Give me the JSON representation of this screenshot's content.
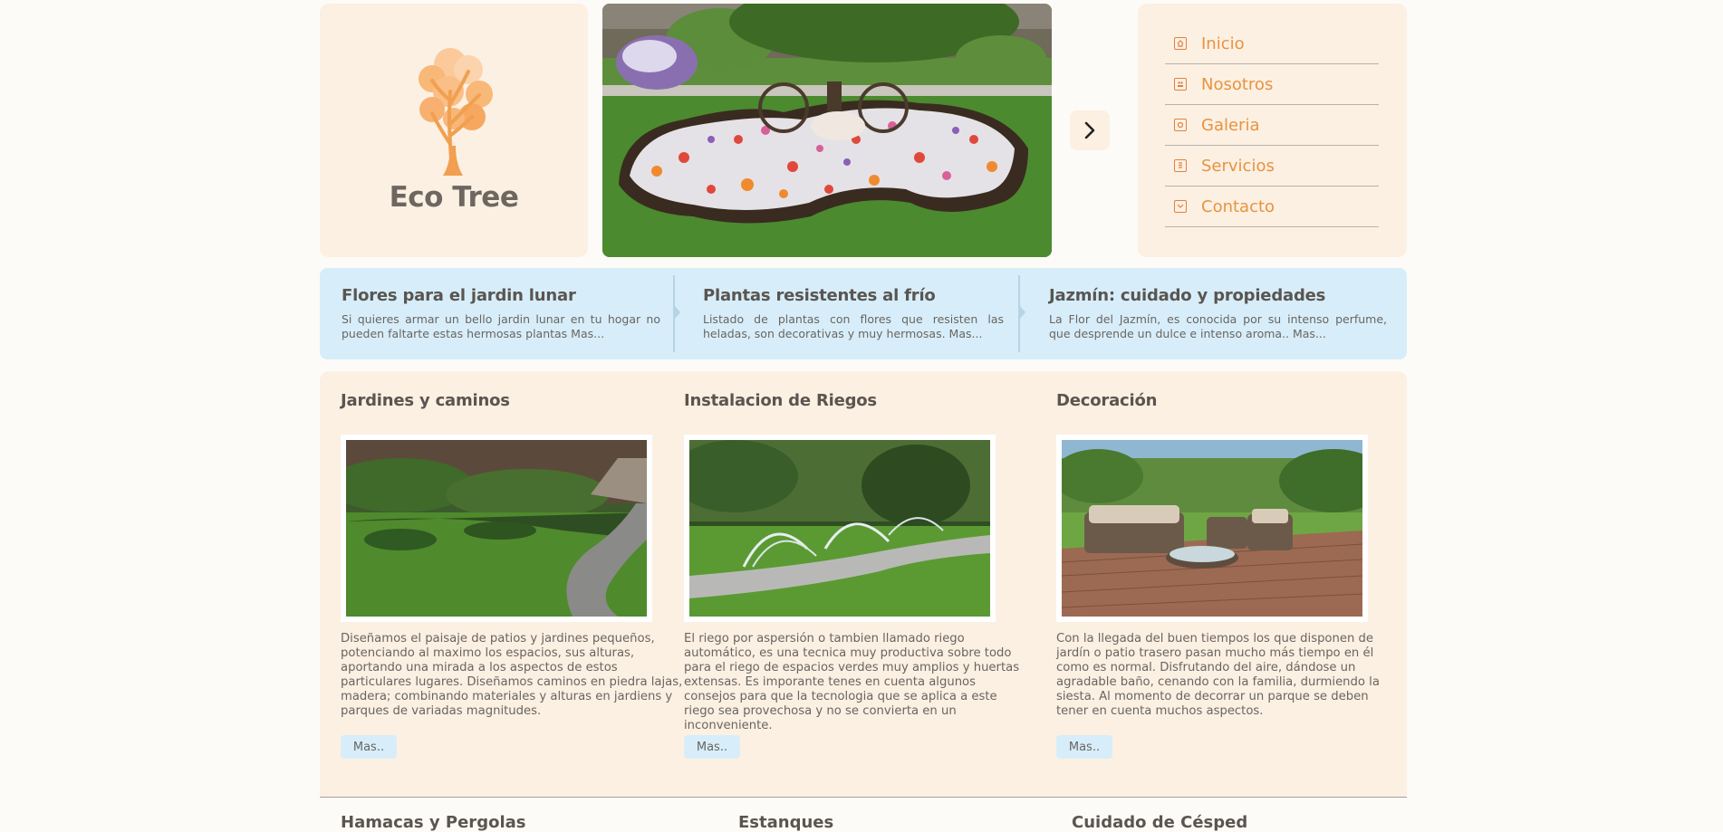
{
  "brand": {
    "name": "Eco Tree"
  },
  "nav": {
    "items": [
      {
        "label": "Inicio",
        "icon": "home-icon"
      },
      {
        "label": "Nosotros",
        "icon": "people-icon"
      },
      {
        "label": "Galeria",
        "icon": "gallery-icon"
      },
      {
        "label": "Servicios",
        "icon": "document-icon"
      },
      {
        "label": "Contacto",
        "icon": "mail-icon"
      }
    ]
  },
  "slider": {
    "next_icon": "chevron-right-icon"
  },
  "news": [
    {
      "title": "Flores para el jardin lunar",
      "text": "Si quieres armar un bello jardin lunar en tu hogar no pueden faltarte estas hermosas plantas Mas..."
    },
    {
      "title": "Plantas resistentes al frío",
      "text": "Listado de plantas con flores que resisten las heladas, son decorativas y muy hermosas. Mas..."
    },
    {
      "title": "Jazmín: cuidado y propiedades",
      "text": "La Flor del Jazmín, es conocida por su intenso perfume, que desprende un dulce e intenso aroma.. Mas..."
    }
  ],
  "services": [
    {
      "title": "Jardines y caminos",
      "text": "Diseñamos el paisaje de patios y jardines pequeños, potenciando al maximo los espacios, sus alturas, aportando una mirada a los aspectos de estos particulares lugares. Diseñamos caminos en piedra lajas, madera; combinando materiales y alturas en jardiens y parques de variadas magnitudes.",
      "button": "Mas.."
    },
    {
      "title": "Instalacion de Riegos",
      "text": "El riego por aspersión o tambien llamado riego automático, es una tecnica muy productiva sobre todo para el riego de espacios verdes muy amplios y huertas extensas. Es imporante tenes en cuenta algunos consejos para que la tecnologia que se aplica a este riego sea provechosa y no se convierta en un inconveniente.",
      "button": "Mas.."
    },
    {
      "title": "Decoración",
      "text": "Con la llegada del buen tiempos los que disponen de jardín o patio trasero pasan mucho más tiempo en él como es normal. Disfrutando del aire, dándose un agradable baño, cenando con la familia, durmiendo la siesta. Al momento de decorrar un parque se deben tener en cuenta muchos aspectos.",
      "button": "Mas.."
    }
  ],
  "bottom_titles": [
    "Hamacas y Pergolas",
    "Estanques",
    "Cuidado de Césped"
  ],
  "colors": {
    "accent": "#e8933e",
    "panel": "#fcf0e3",
    "news_bg": "#d7eefa",
    "text": "#6b6158"
  }
}
